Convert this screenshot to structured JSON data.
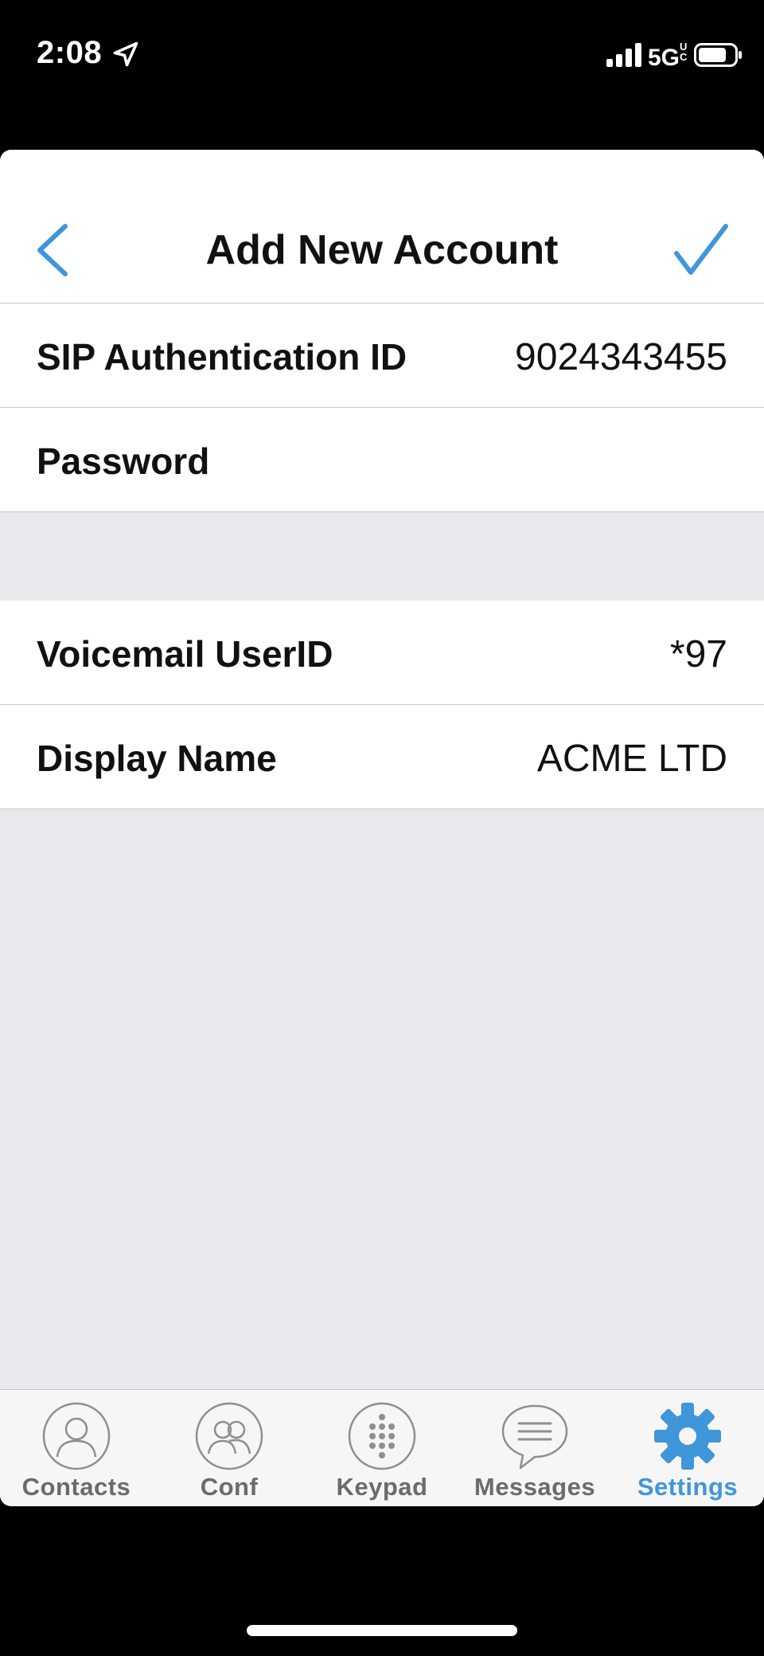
{
  "status_bar": {
    "time": "2:08",
    "network": "5G",
    "network_suffix": "UC"
  },
  "header": {
    "title": "Add New Account",
    "back_icon": "chevron-left-icon",
    "done_icon": "checkmark-icon"
  },
  "form": {
    "group1": [
      {
        "label": "SIP Authentication ID",
        "value": "9024343455"
      },
      {
        "label": "Password",
        "value": ""
      }
    ],
    "group2": [
      {
        "label": "Voicemail UserID",
        "value": "*97"
      },
      {
        "label": "Display Name",
        "value": "ACME LTD"
      }
    ]
  },
  "tabs": [
    {
      "label": "Contacts",
      "icon": "contact-icon",
      "active": false
    },
    {
      "label": "Conf",
      "icon": "conference-icon",
      "active": false
    },
    {
      "label": "Keypad",
      "icon": "keypad-icon",
      "active": false
    },
    {
      "label": "Messages",
      "icon": "message-icon",
      "active": false
    },
    {
      "label": "Settings",
      "icon": "gear-icon",
      "active": true
    }
  ],
  "colors": {
    "accent": "#3f96d9",
    "background": "#e8e9ec",
    "text": "#111111",
    "tab_inactive": "#6b6b6e"
  }
}
